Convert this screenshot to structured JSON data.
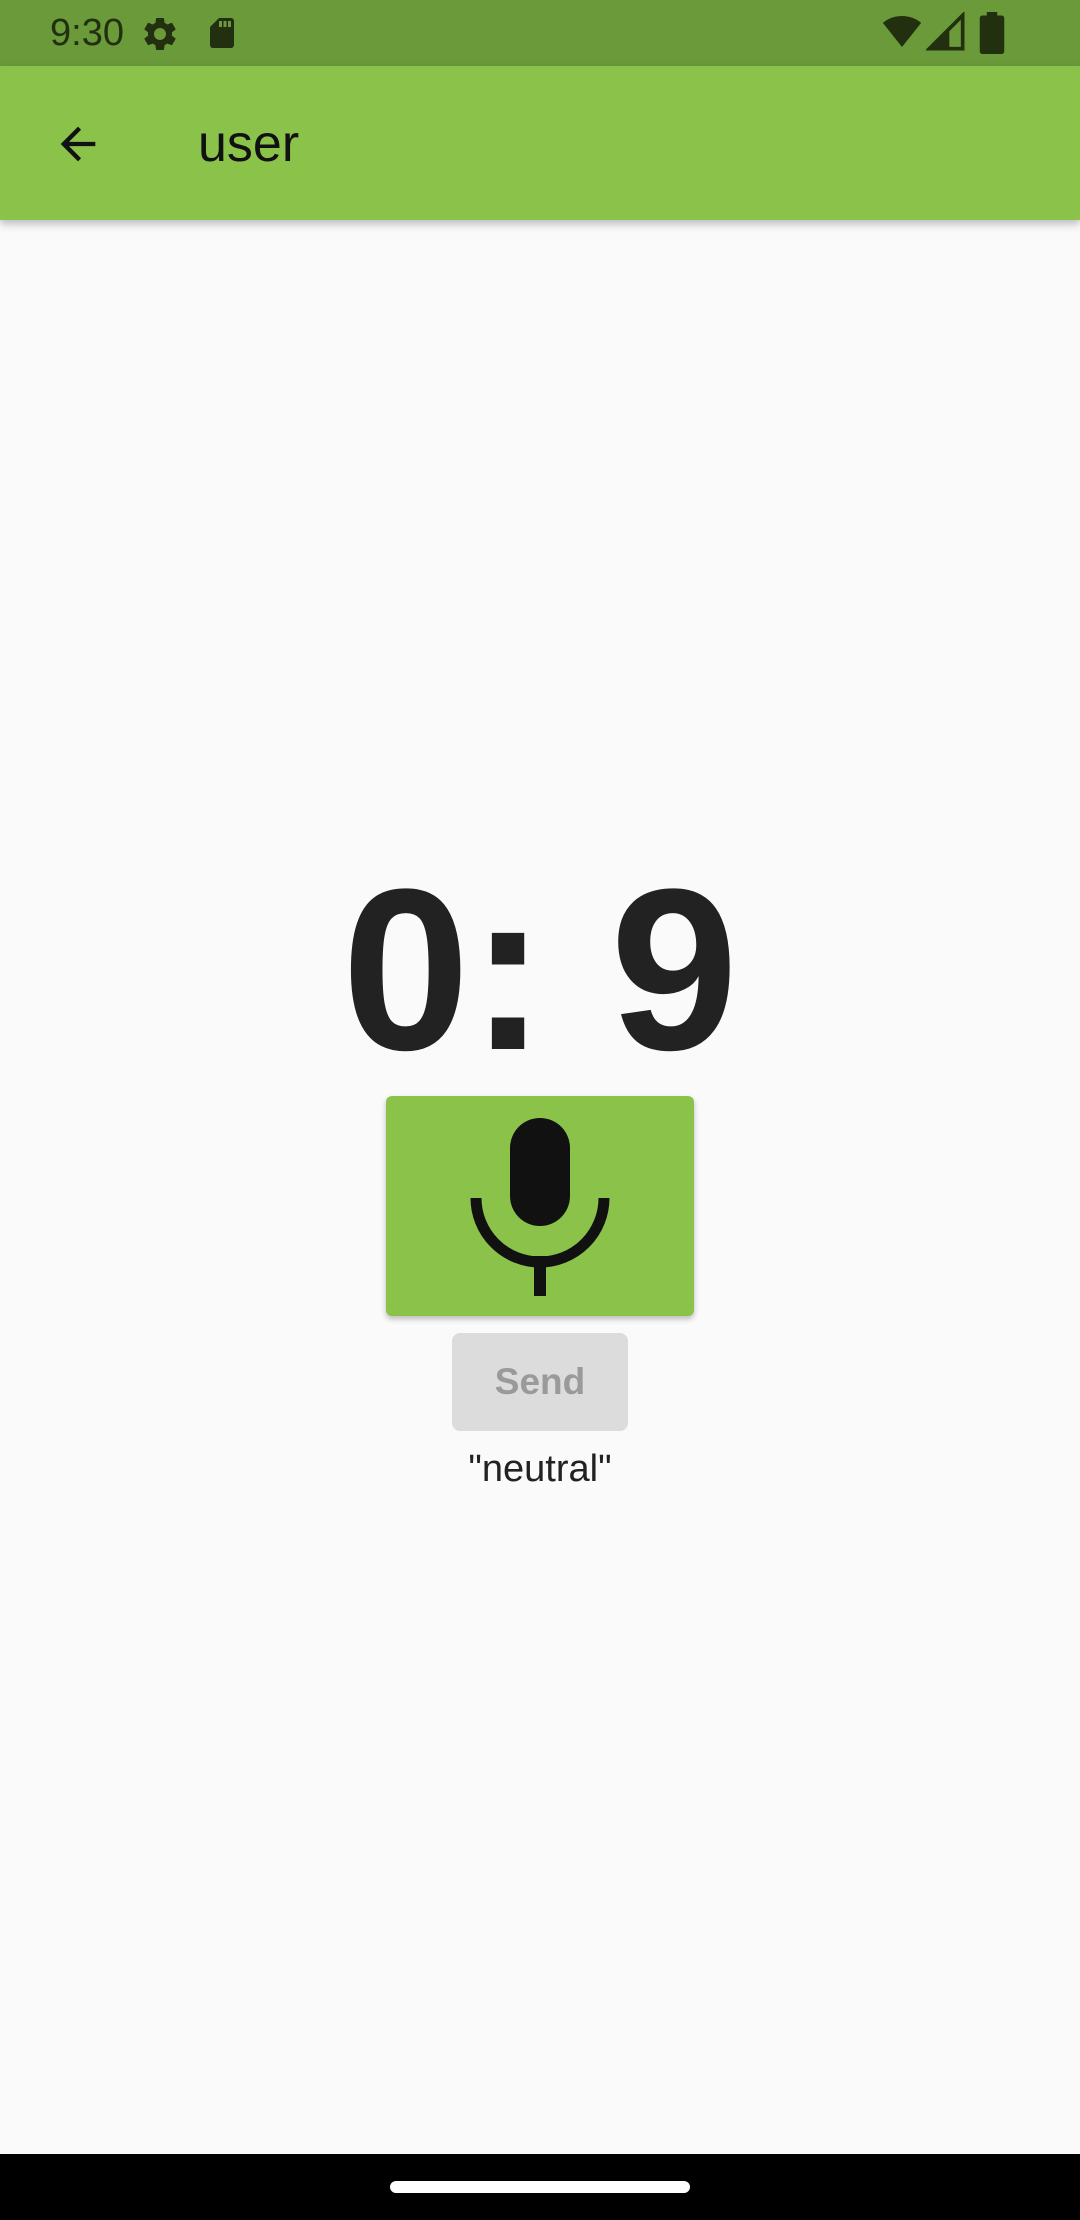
{
  "status_bar": {
    "time": "9:30",
    "icons": [
      "settings-icon",
      "sd-card-icon",
      "wifi-icon",
      "signal-icon",
      "battery-icon"
    ]
  },
  "app_bar": {
    "title": "user",
    "back_icon": "arrow-back-icon",
    "background_color": "#8bc34a"
  },
  "main": {
    "timer": "0: 9",
    "mic_icon": "microphone-icon",
    "send_label": "Send",
    "send_enabled": false,
    "emotion": "\"neutral\""
  },
  "colors": {
    "status_bar": "#6b9a3a",
    "accent": "#8bc34a",
    "background": "#fafafa"
  }
}
